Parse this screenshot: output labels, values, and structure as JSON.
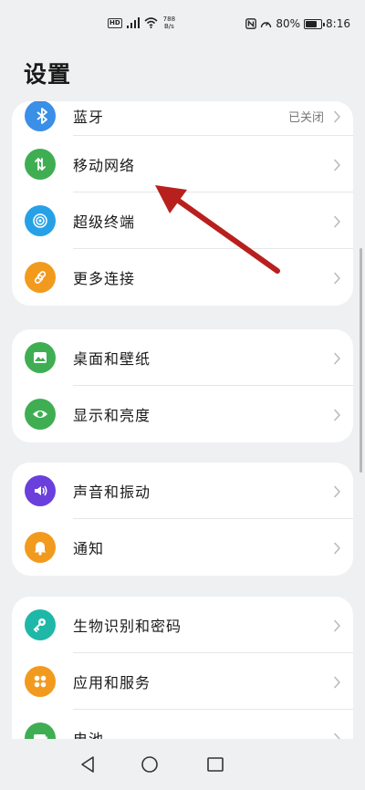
{
  "status": {
    "hd": "HD",
    "speed_value": "788",
    "speed_unit": "B/s",
    "battery": "80%",
    "battery_level": 0.8,
    "time": "8:16"
  },
  "title": "设置",
  "groups": [
    {
      "items": [
        {
          "label": "蓝牙",
          "value": "已关闭",
          "icon": "bluetooth-icon",
          "color": "#3a8fe6"
        },
        {
          "label": "移动网络",
          "value": "",
          "icon": "mobile-network-icon",
          "color": "#3fae53"
        },
        {
          "label": "超级终端",
          "value": "",
          "icon": "super-device-icon",
          "color": "#27a1e6"
        },
        {
          "label": "更多连接",
          "value": "",
          "icon": "link-icon",
          "color": "#f29a1e"
        }
      ]
    },
    {
      "items": [
        {
          "label": "桌面和壁纸",
          "value": "",
          "icon": "wallpaper-icon",
          "color": "#3fae53"
        },
        {
          "label": "显示和亮度",
          "value": "",
          "icon": "eye-icon",
          "color": "#3fae53"
        }
      ]
    },
    {
      "items": [
        {
          "label": "声音和振动",
          "value": "",
          "icon": "sound-icon",
          "color": "#6a3fdb"
        },
        {
          "label": "通知",
          "value": "",
          "icon": "bell-icon",
          "color": "#f29a1e"
        }
      ]
    },
    {
      "items": [
        {
          "label": "生物识别和密码",
          "value": "",
          "icon": "key-icon",
          "color": "#1fb8a8"
        },
        {
          "label": "应用和服务",
          "value": "",
          "icon": "apps-icon",
          "color": "#f29a1e"
        },
        {
          "label": "电池",
          "value": "",
          "icon": "battery-icon",
          "color": "#3fae53"
        }
      ]
    }
  ],
  "nav": {
    "back": "back-icon",
    "home": "home-icon",
    "recents": "recents-icon"
  },
  "annotation": {
    "color": "#b8201d"
  }
}
